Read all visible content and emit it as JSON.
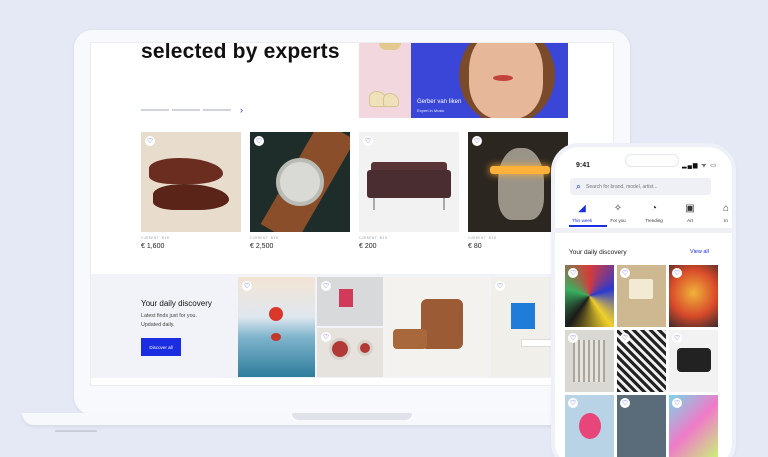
{
  "hero": {
    "title": "selected by experts",
    "expert_name": "Gerber van Iiken",
    "expert_role": "Expert in Music"
  },
  "products": [
    {
      "bid_label": "CURRENT BID",
      "price": "€ 1,600",
      "image": "leather-loafers"
    },
    {
      "bid_label": "CURRENT BID",
      "price": "€ 2,500",
      "image": "wristwatch"
    },
    {
      "bid_label": "CURRENT BID",
      "price": "€ 200",
      "image": "leather-sofa"
    },
    {
      "bid_label": "CURRENT BID",
      "price": "€ 80",
      "image": "neon-bust"
    }
  ],
  "discovery": {
    "title": "Your daily discovery",
    "line1": "Latest finds just for you.",
    "line2": "Updated daily.",
    "button": "Discover all"
  },
  "phone": {
    "time": "9:41",
    "status": "▂▄▆ ᯤ ▭",
    "search_placeholder": "Search for brand, model, artist...",
    "tabs": [
      {
        "label": "This week",
        "icon": "◢"
      },
      {
        "label": "For you",
        "icon": "✧"
      },
      {
        "label": "Trending",
        "icon": "◔"
      },
      {
        "label": "Art",
        "icon": "▣"
      },
      {
        "label": "In",
        "icon": "⌂"
      }
    ],
    "discovery_title": "Your daily discovery",
    "view_all": "View all"
  },
  "colors": {
    "accent": "#1b2de0",
    "background": "#e4e9f5"
  },
  "icons": {
    "favorite": "heart-icon",
    "search": "search-icon",
    "carousel_next": "chevron-right-icon"
  },
  "glyphs": {
    "heart": "♡",
    "chevron": "›",
    "search": "⌕"
  }
}
